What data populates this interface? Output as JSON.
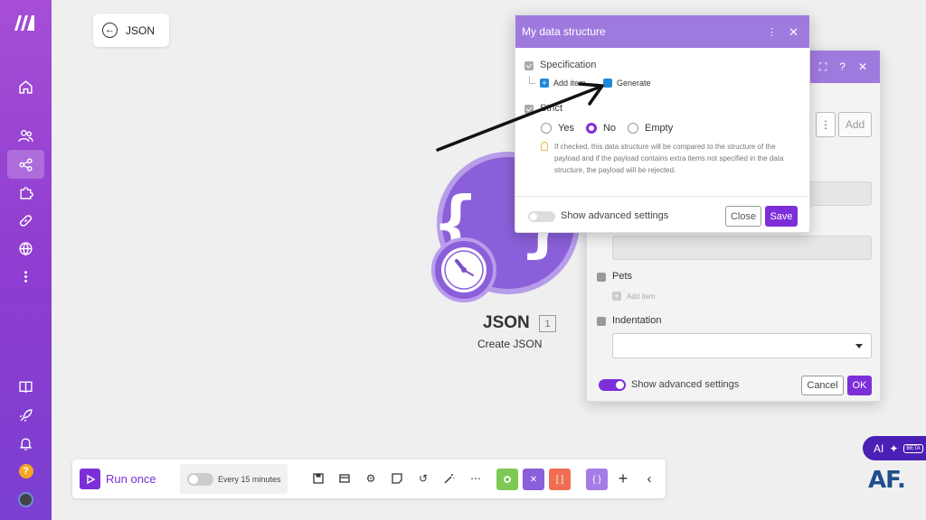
{
  "back_pill": {
    "label": "JSON"
  },
  "module": {
    "name": "JSON",
    "badge": "1",
    "subtitle": "Create JSON"
  },
  "dialog": {
    "title": "My data structure",
    "specification_label": "Specification",
    "add_item_label": "Add item",
    "generate_label": "Generate",
    "strict_label": "Strict",
    "radio_options": [
      "Yes",
      "No",
      "Empty"
    ],
    "selected_option": "No",
    "hint": "If checked, this data structure will be compared to the structure of the payload and if the payload contains extra items not specified in the data structure, the payload will be rejected.",
    "advanced_label": "Show advanced settings",
    "close_label": "Close",
    "save_label": "Save"
  },
  "panel": {
    "add_label": "Add",
    "pets_label": "Pets",
    "pets_add_item": "Add item",
    "indentation_label": "Indentation",
    "advanced_label": "Show advanced settings",
    "cancel_label": "Cancel",
    "ok_label": "OK"
  },
  "toolbar": {
    "run_label": "Run once",
    "schedule_label": "Every 15 minutes",
    "icons": [
      "save-icon",
      "notes-icon",
      "settings-icon",
      "note-icon",
      "undo-icon",
      "magic-wand-icon",
      "more-icon",
      "tools-icon",
      "flow-icon",
      "text-parser-icon",
      "json-icon",
      "add-icon",
      "collapse-icon"
    ]
  },
  "ai": {
    "label": "AI",
    "beta": "BETA"
  },
  "watermark": "AF.",
  "colors": {
    "accent": "#7c2fd8",
    "header": "#9f7ade",
    "sidebar": "#a64ed6"
  }
}
